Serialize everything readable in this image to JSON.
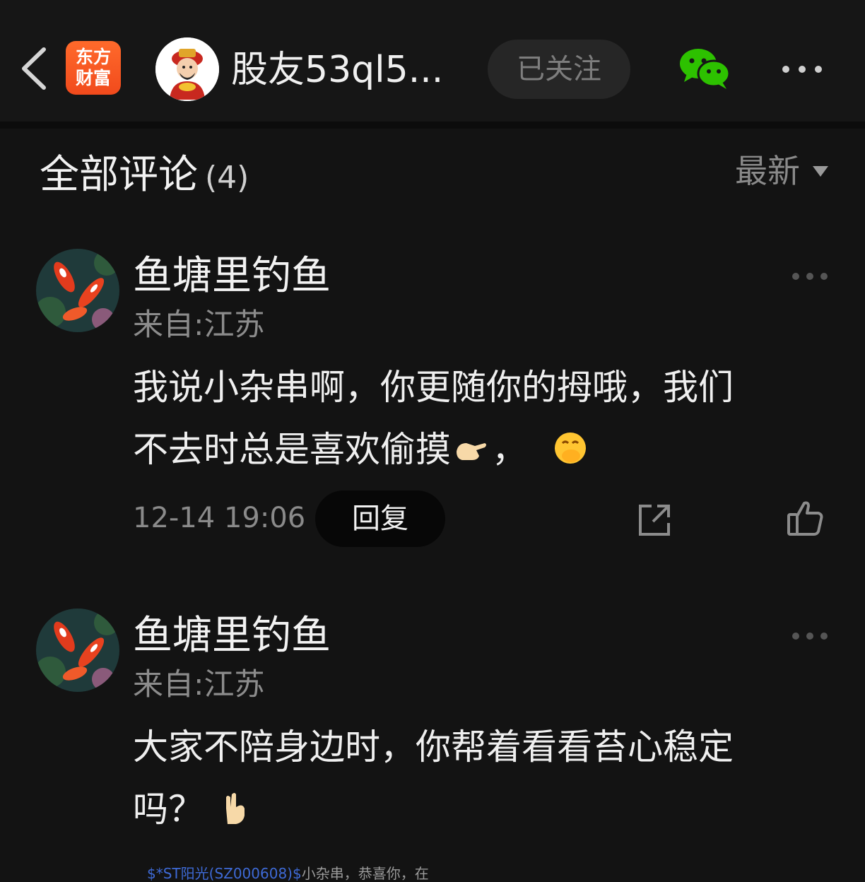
{
  "header": {
    "app_logo_line1": "东方",
    "app_logo_line2": "财富",
    "user_name": "股友53ql5...",
    "follow_label": "已关注"
  },
  "comments_section": {
    "title": "全部评论",
    "count": "(4)",
    "sort_label": "最新"
  },
  "comments": [
    {
      "name": "鱼塘里钓鱼",
      "location": "来自:江苏",
      "text_line1": "我说小杂串啊，你更随你的拇哦，我们",
      "text_line2": "不去时总是喜欢偷摸",
      "text_line2_after": "，",
      "emoji": [
        "pointing-hand",
        "hand-over-mouth-face"
      ],
      "time": "12-14 19:06",
      "reply_label": "回复"
    },
    {
      "name": "鱼塘里钓鱼",
      "location": "来自:江苏",
      "text_line1": "大家不陪身边时，你帮着看看苔心稳定",
      "text_line2": "吗？",
      "emoji": [
        "hand-sign"
      ]
    }
  ],
  "bottom_peek": {
    "stock": "$*ST阳光(SZ000608)$",
    "text": "小杂串，恭喜你，在"
  },
  "colors": {
    "background": "#131313",
    "accent_orange": "#f14a1c",
    "wechat_green": "#2dc100",
    "link_blue": "#3e6ad6"
  }
}
